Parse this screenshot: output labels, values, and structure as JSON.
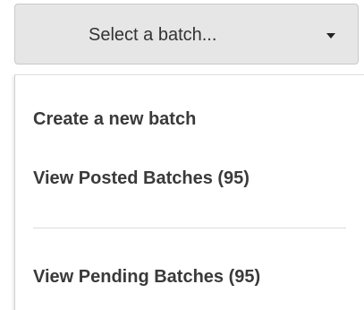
{
  "select": {
    "label": "Select a batch...",
    "caret_icon": "caret-down-icon"
  },
  "menu": {
    "items": [
      {
        "label": "Create a new batch"
      },
      {
        "label": "View Posted Batches (95)"
      },
      {
        "label": "View Pending Batches (95)"
      }
    ]
  },
  "colors": {
    "button_bg": "#e6e6e6",
    "menu_text": "#3a3a3a",
    "divider": "#dcdcdc"
  }
}
